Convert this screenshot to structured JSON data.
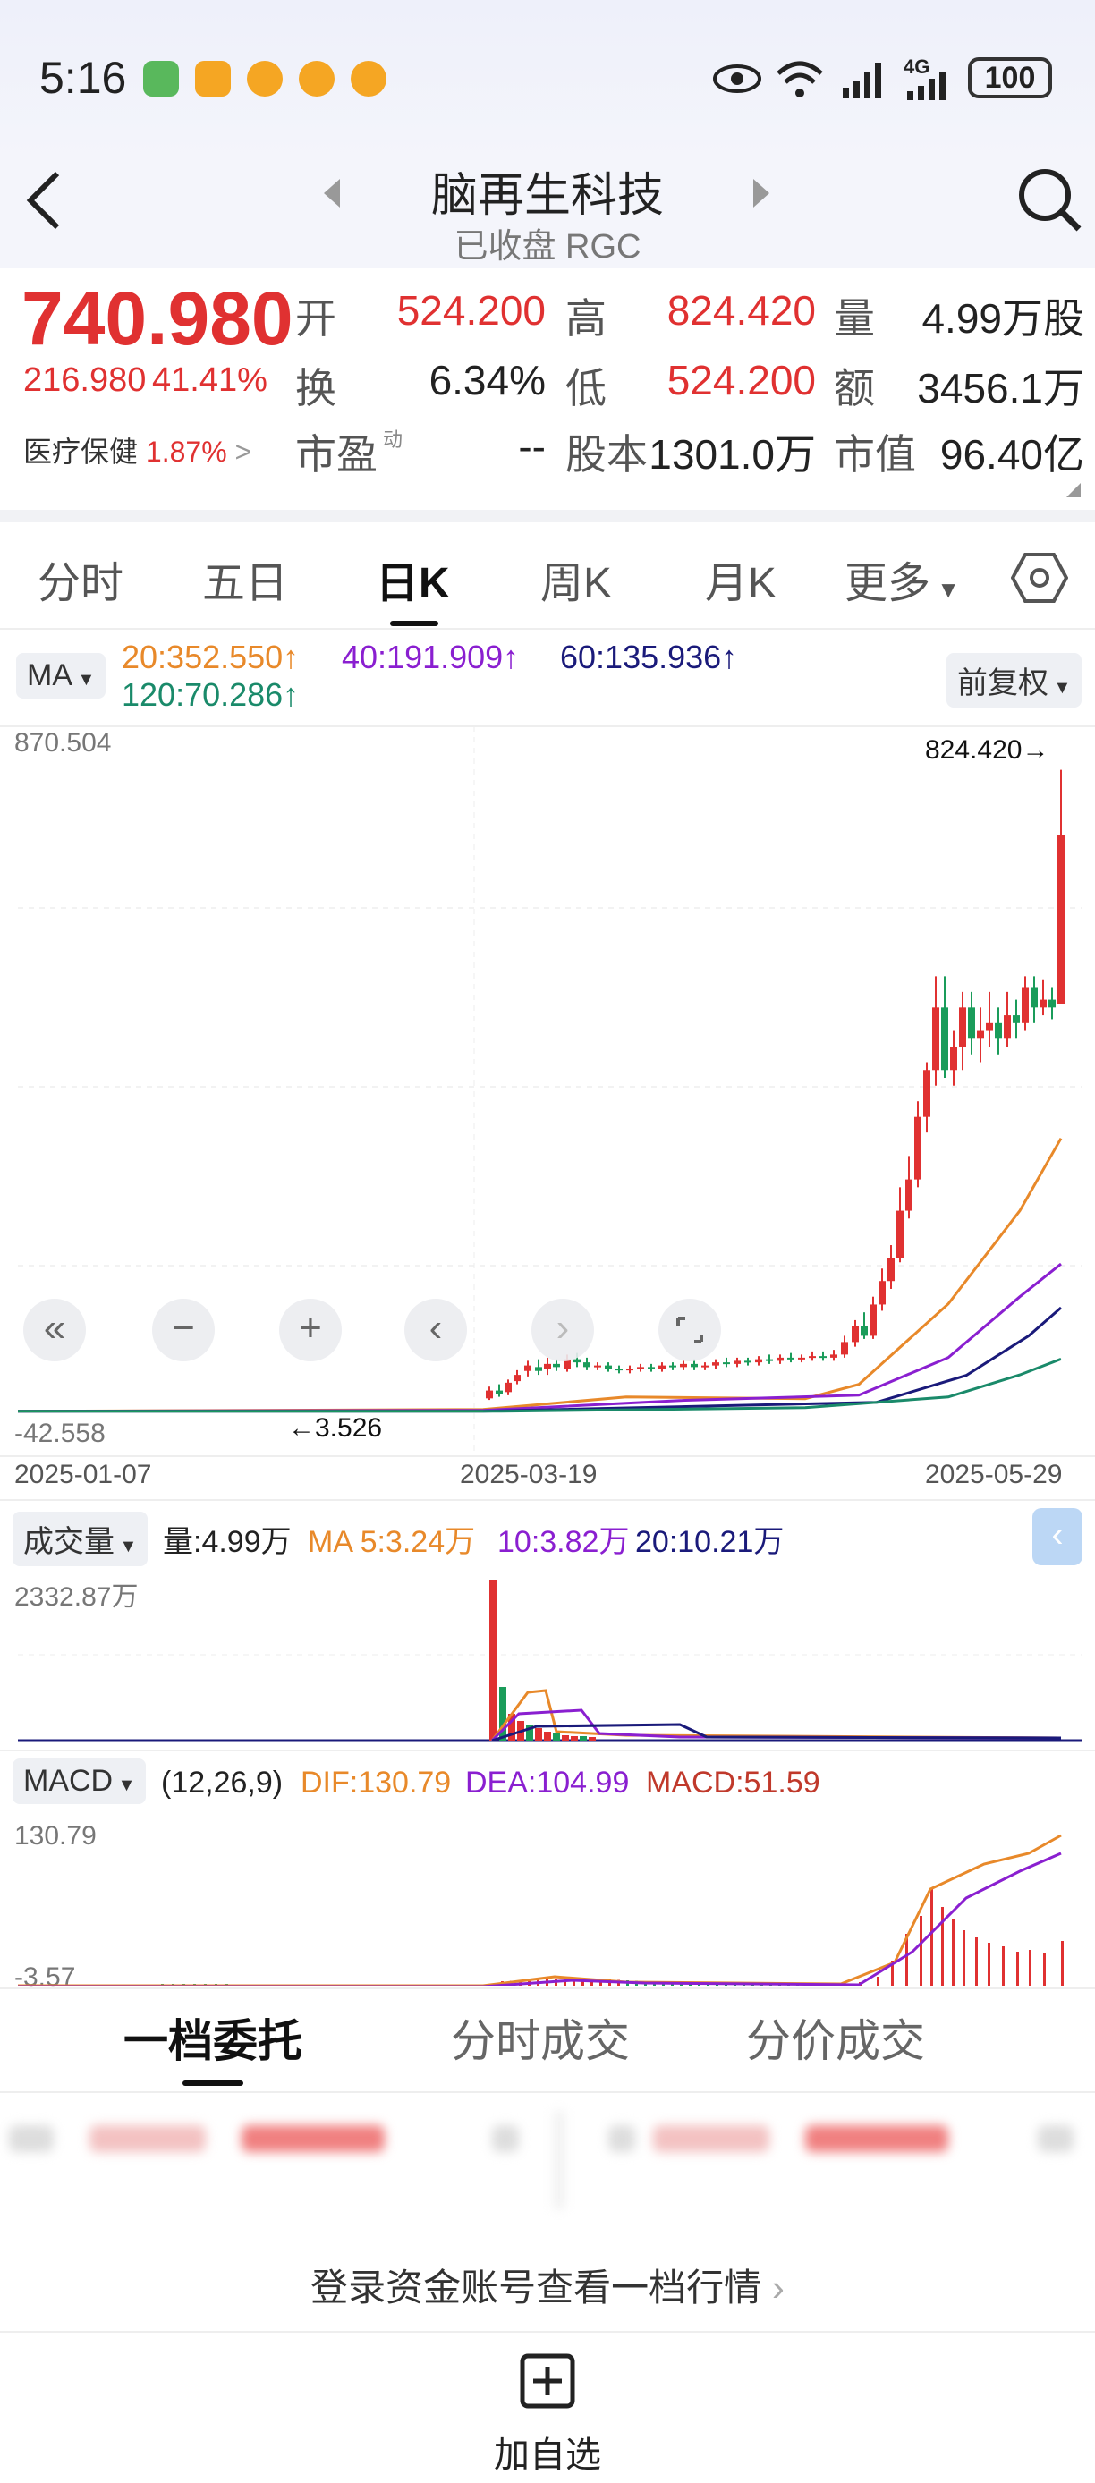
{
  "status_bar": {
    "time": "5:16",
    "network": "4G",
    "battery": "100",
    "icons": [
      "sim-icon",
      "app-icon",
      "weibo-icon",
      "weibo-icon",
      "weibo-icon",
      "eye-icon",
      "wifi-icon",
      "signal-icon"
    ]
  },
  "header": {
    "title": "脑再生科技",
    "subtitle": "已收盘 RGC"
  },
  "quote": {
    "price": "740.980",
    "change": "216.980",
    "change_pct": "41.41%",
    "open_label": "开",
    "open": "524.200",
    "high_label": "高",
    "high": "824.420",
    "volume_label": "量",
    "volume": "4.99万股",
    "turnover_label": "换",
    "turnover": "6.34%",
    "low_label": "低",
    "low": "524.200",
    "amount_label": "额",
    "amount": "3456.1万",
    "sector": "医疗保健",
    "sector_pct": "1.87%",
    "pe_label": "市盈",
    "pe_sup": "动",
    "pe": "--",
    "shares_label": "股本",
    "shares": "1301.0万",
    "mktcap_label": "市值",
    "mktcap": "96.40亿"
  },
  "tabs": [
    "分时",
    "五日",
    "日K",
    "周K",
    "月K",
    "更多"
  ],
  "ma_row": {
    "selector": "MA",
    "ma20": "20:352.550↑",
    "ma40": "40:191.909↑",
    "ma60": "60:135.936↑",
    "ma120": "120:70.286↑",
    "adjust": "前复权"
  },
  "kline": {
    "y_max": "870.504",
    "y_min": "-42.558",
    "high_marker": "824.420→",
    "low_marker": "←3.526",
    "dates": [
      "2025-01-07",
      "2025-03-19",
      "2025-05-29"
    ]
  },
  "volume_panel": {
    "selector": "成交量",
    "vol": "量:4.99万",
    "ma5": "MA 5:3.24万",
    "ma10": "10:3.82万",
    "ma20": "20:10.21万",
    "y_max": "2332.87万"
  },
  "macd_panel": {
    "selector": "MACD",
    "params": "(12,26,9)",
    "dif": "DIF:130.79",
    "dea": "DEA:104.99",
    "macd": "MACD:51.59",
    "y_max": "130.79",
    "y_min": "-3.57"
  },
  "bottom_tabs": [
    "一档委托",
    "分时成交",
    "分价成交"
  ],
  "login_prompt": "登录资金账号查看一档行情",
  "add_watch": "加自选",
  "colors": {
    "up": "#e03131",
    "down": "#1a9c5a",
    "ma20": "#e8892a",
    "ma40": "#8a1fd0",
    "ma60": "#1a1a7a",
    "ma120": "#1a8a6a"
  }
}
